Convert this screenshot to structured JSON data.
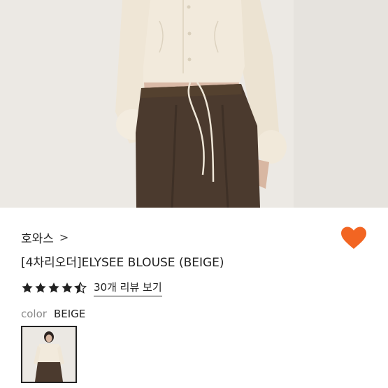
{
  "product": {
    "brand": "호와스",
    "brand_chevron": ">",
    "title": "[4차리오더]ELYSEE BLOUSE (BEIGE)",
    "rating": 4.5,
    "review_link": "30개 리뷰 보기",
    "color_label": "color",
    "color_value": "BEIGE",
    "liked": true
  },
  "colors": {
    "heart": "#f26522",
    "star": "#222222"
  },
  "icons": {
    "heart": "heart-icon",
    "star": "star-icon",
    "chevron": "chevron-right-icon"
  }
}
